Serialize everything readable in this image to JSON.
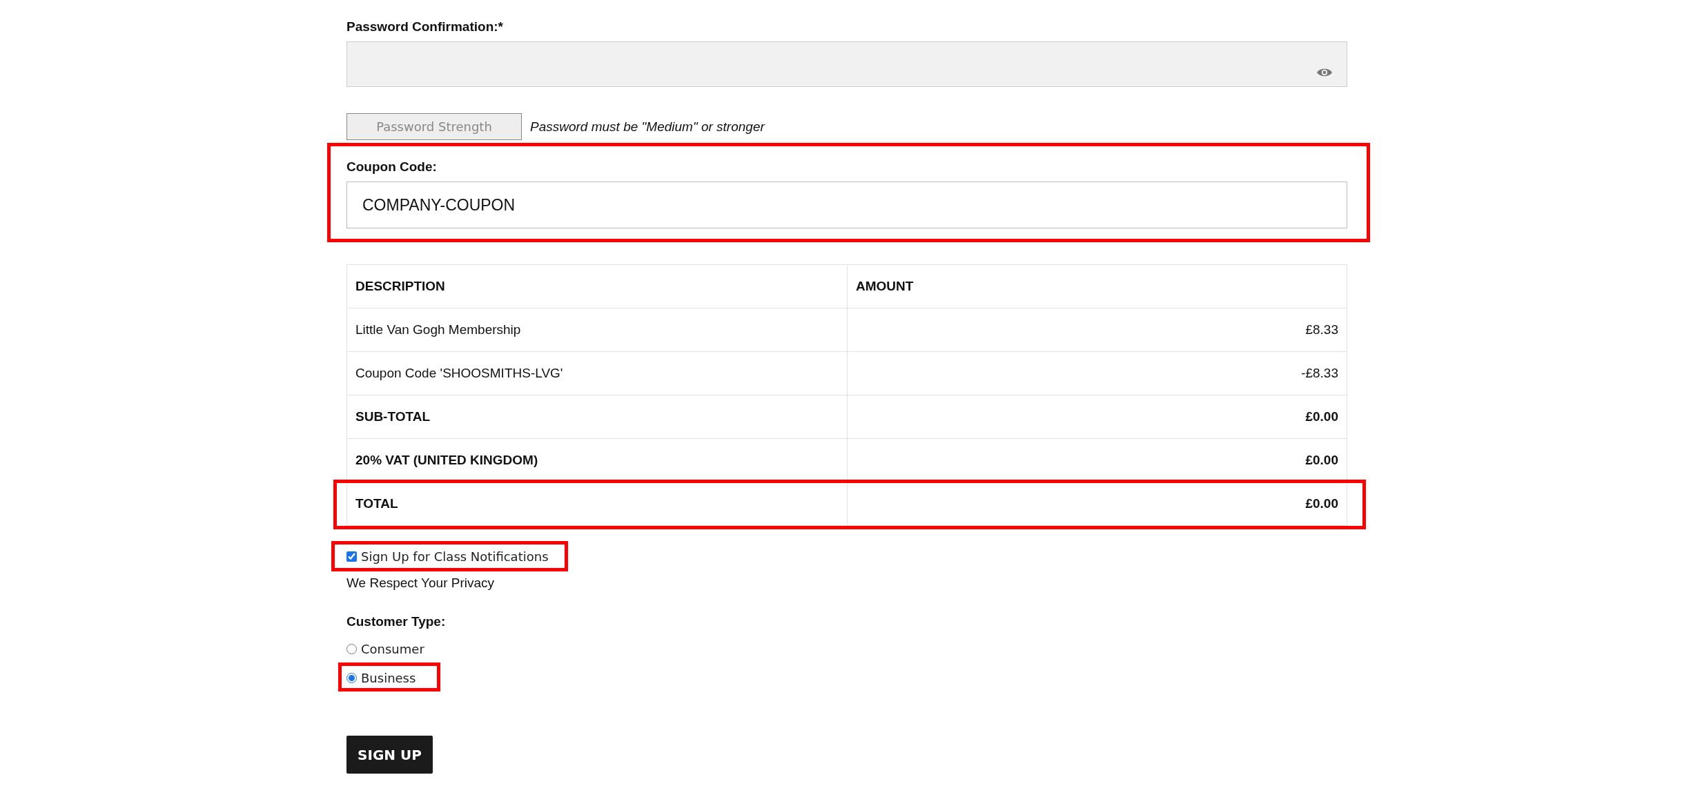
{
  "password_confirmation": {
    "label": "Password Confirmation:*"
  },
  "password_strength": {
    "label": "Password Strength",
    "hint": "Password must be \"Medium\" or stronger"
  },
  "coupon": {
    "label": "Coupon Code:",
    "value": "COMPANY-COUPON",
    "highlighted": true
  },
  "table": {
    "columns": [
      "DESCRIPTION",
      "AMOUNT"
    ],
    "rows": [
      {
        "description": "Little Van Gogh Membership",
        "amount": "£8.33",
        "bold": false,
        "highlighted": false
      },
      {
        "description": "Coupon Code 'SHOOSMITHS-LVG'",
        "amount": "-£8.33",
        "bold": false,
        "highlighted": false
      },
      {
        "description": "SUB-TOTAL",
        "amount": "£0.00",
        "bold": true,
        "highlighted": false
      },
      {
        "description": "20% VAT (UNITED KINGDOM)",
        "amount": "£0.00",
        "bold": true,
        "highlighted": false
      },
      {
        "description": "TOTAL",
        "amount": "£0.00",
        "bold": true,
        "highlighted": true
      }
    ]
  },
  "notifications": {
    "label": "Sign Up for Class Notifications",
    "checked": true,
    "highlighted": true
  },
  "privacy_note": "We Respect Your Privacy",
  "customer_type": {
    "label": "Customer Type:",
    "options": [
      {
        "label": "Consumer",
        "selected": false,
        "highlighted": false
      },
      {
        "label": "Business",
        "selected": true,
        "highlighted": true
      }
    ]
  },
  "submit": "SIGN UP"
}
